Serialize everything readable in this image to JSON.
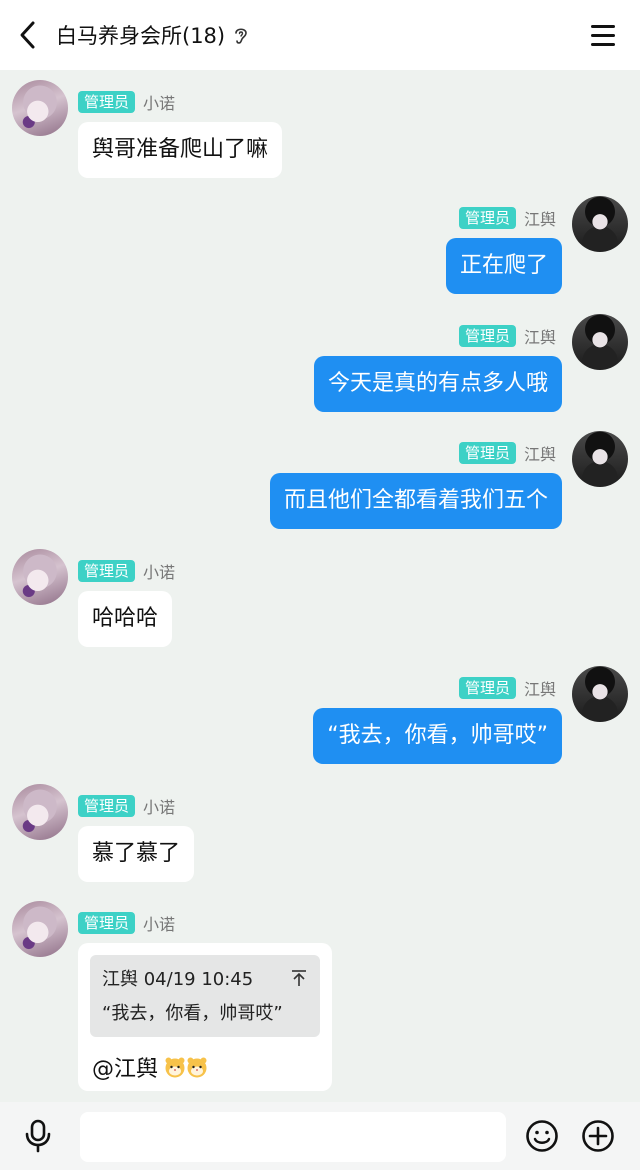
{
  "header": {
    "title": "白马养身会所(18)",
    "back_icon": "chevron-left-icon",
    "ear_icon": "ear-icon",
    "menu_icon": "hamburger-menu-icon"
  },
  "badge_label": "管理员",
  "messages": [
    {
      "side": "left",
      "sender": "小诺",
      "text": "舆哥准备爬山了嘛"
    },
    {
      "side": "right",
      "sender": "江舆",
      "text": "正在爬了"
    },
    {
      "side": "right",
      "sender": "江舆",
      "text": "今天是真的有点多人哦"
    },
    {
      "side": "right",
      "sender": "江舆",
      "text": "而且他们全都看着我们五个"
    },
    {
      "side": "left",
      "sender": "小诺",
      "text": "哈哈哈"
    },
    {
      "side": "right",
      "sender": "江舆",
      "text": "“我去，你看，帅哥哎”"
    },
    {
      "side": "left",
      "sender": "小诺",
      "text": "慕了慕了"
    },
    {
      "side": "left",
      "sender": "小诺",
      "quote": {
        "header": "江舆 04/19 10:45",
        "text": "“我去，你看，帅哥哎”"
      },
      "text": "@江舆"
    }
  ],
  "bottom": {
    "input_value": "",
    "voice_icon": "microphone-icon",
    "emoji_icon": "smiley-icon",
    "add_icon": "plus-circle-icon"
  },
  "colors": {
    "page_bg": "#eef2ef",
    "badge": "#3dd1c6",
    "right_bubble": "#1f8ff2",
    "left_bubble": "#ffffff"
  }
}
